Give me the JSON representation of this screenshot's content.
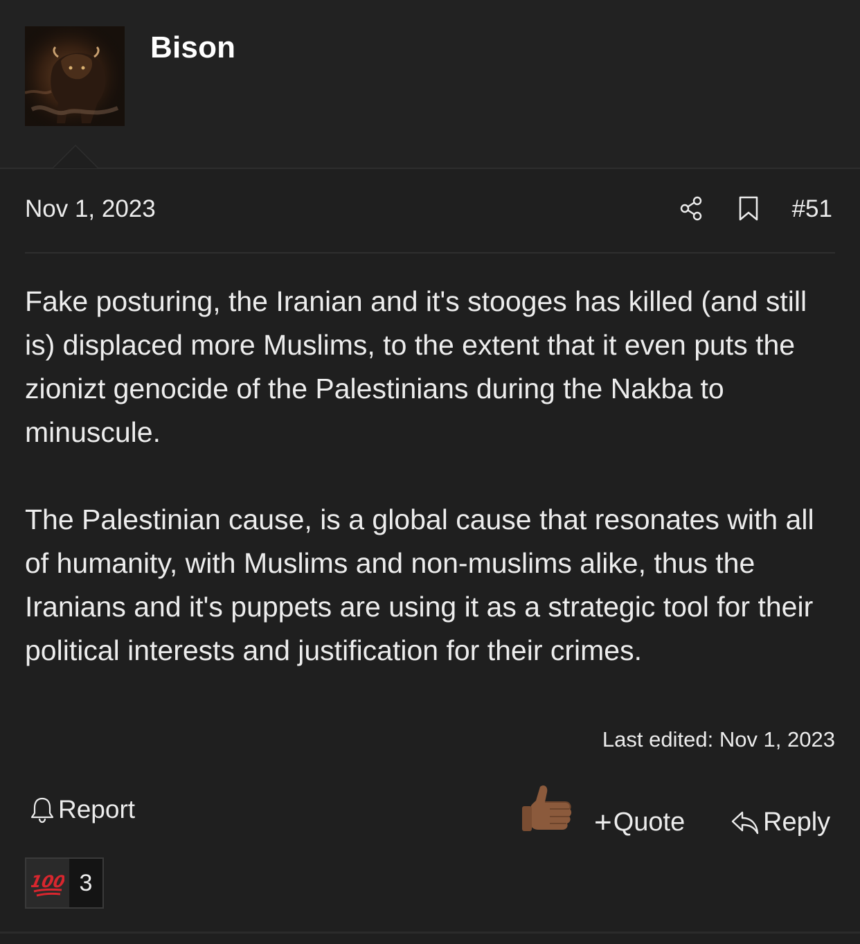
{
  "post": {
    "author": "Bison",
    "date": "Nov 1, 2023",
    "number": "#51",
    "paragraphs": [
      "Fake posturing, the Iranian and it's stooges has killed (and still is) displaced more Muslims, to the extent that it even puts the zionizt genocide of the Palestinians during the Nakba to minuscule.",
      "The Palestinian cause, is a global cause that resonates with all of humanity, with Muslims and non-muslims alike, thus the Iranians and it's puppets are using it as a strategic tool for their political interests and justification for their crimes."
    ],
    "last_edited": "Last edited: Nov 1, 2023"
  },
  "actions": {
    "report_label": "Report",
    "quote_label": "Quote",
    "reply_label": "Reply"
  },
  "reactions": {
    "emoji": "100",
    "count": "3"
  },
  "icons": {
    "share": "share-icon",
    "bookmark": "bookmark-icon",
    "bell": "bell-icon",
    "thumbs_up": "thumbs-up-icon",
    "reply": "reply-arrow-icon",
    "hundred": "hundred-points-icon"
  },
  "colors": {
    "background": "#1f1f1f",
    "header_background": "#222222",
    "text": "#ececec",
    "thumb_tone": "#8b5a3c",
    "hundred_red": "#d8262e"
  }
}
